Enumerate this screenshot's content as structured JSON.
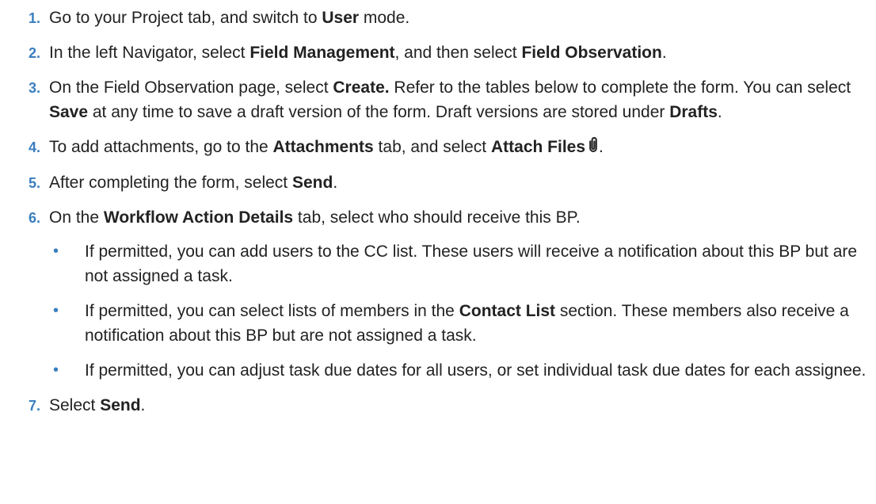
{
  "steps": [
    {
      "number": "1.",
      "segments": [
        "Go to your Project tab, and switch to ",
        "User",
        " mode."
      ]
    },
    {
      "number": "2.",
      "segments": [
        "In the left Navigator, select ",
        "Field Management",
        ", and then select ",
        "Field Observation",
        "."
      ]
    },
    {
      "number": "3.",
      "segments": [
        "On the Field Observation page, select ",
        "Create.",
        " Refer to the tables below to complete the form. You can select ",
        "Save",
        " at any time to save a draft version of the form. Draft versions are stored under ",
        "Drafts",
        "."
      ]
    },
    {
      "number": "4.",
      "segments": [
        "To add attachments, go to the ",
        "Attachments",
        " tab, and select ",
        "Attach Files",
        "."
      ]
    },
    {
      "number": "5.",
      "segments": [
        "After completing the form, select ",
        "Send",
        "."
      ]
    },
    {
      "number": "6.",
      "segments": [
        "On the ",
        "Workflow Action Details",
        " tab, select who should receive this BP."
      ],
      "bullets": [
        {
          "marker": "•",
          "segments": [
            "If permitted, you can add users to the CC list. These users will receive a notification about this BP but are not assigned a task."
          ]
        },
        {
          "marker": "•",
          "segments": [
            "If permitted, you can select lists of members in the ",
            "Contact List",
            " section. These members also receive a notification about this BP but are not assigned a task."
          ]
        },
        {
          "marker": "•",
          "segments": [
            "If permitted, you can adjust task due dates for all users, or set individual task due dates for each assignee."
          ]
        }
      ]
    },
    {
      "number": "7.",
      "segments": [
        "Select ",
        "Send",
        "."
      ]
    }
  ],
  "icons": {
    "attach": "paperclip-icon"
  },
  "colors": {
    "step_number": "#3a7ebf",
    "text": "#222222",
    "background": "#ffffff"
  }
}
